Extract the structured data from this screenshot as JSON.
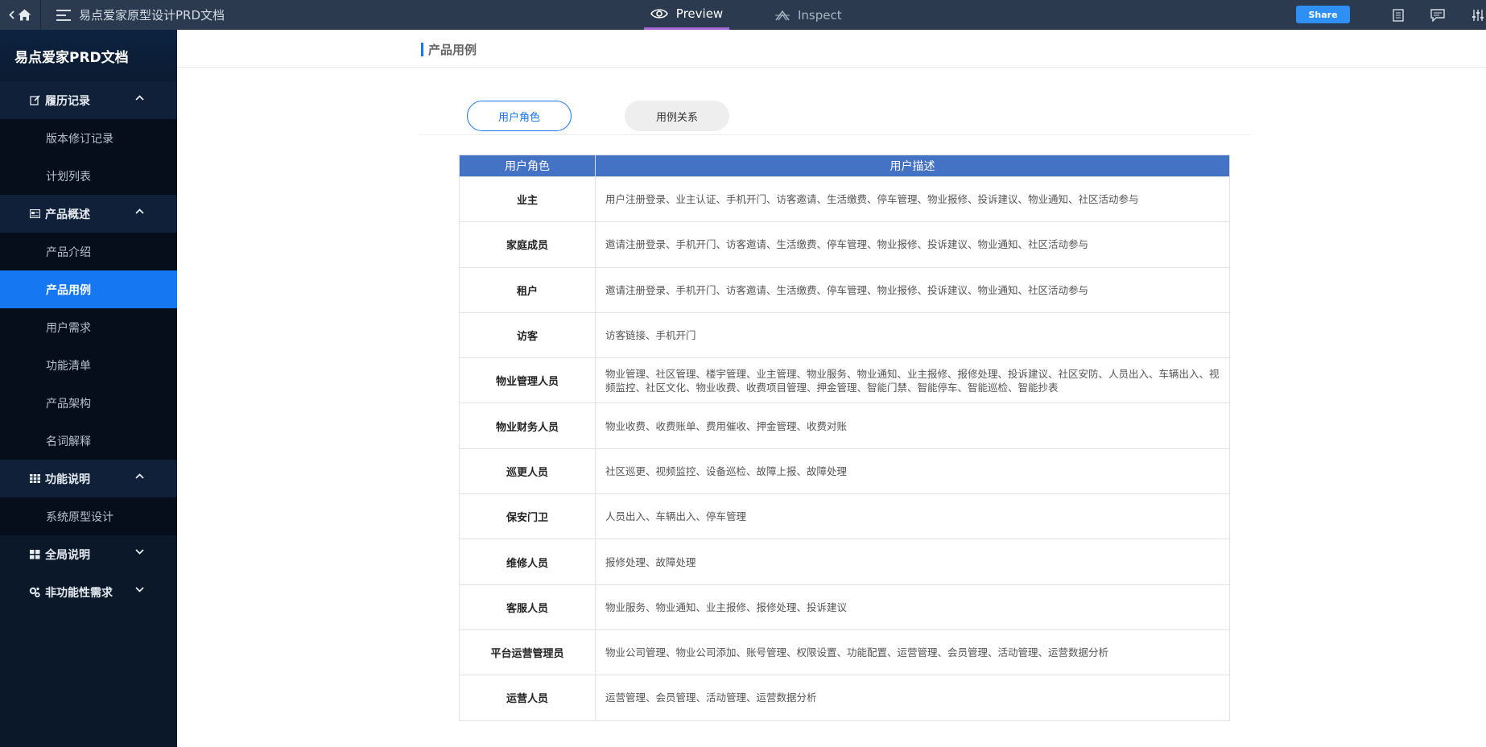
{
  "topbar": {
    "doc_title": "易点爱家原型设计PRD文档",
    "tabs": {
      "preview": "Preview",
      "inspect": "Inspect"
    },
    "share_label": "Share"
  },
  "sidebar": {
    "header": "易点爱家PRD文档",
    "groups": [
      {
        "label": "履历记录",
        "icon": "edit-icon",
        "expanded": true,
        "items": [
          "版本修订记录",
          "计划列表"
        ]
      },
      {
        "label": "产品概述",
        "icon": "document-icon",
        "expanded": true,
        "items": [
          "产品介绍",
          "产品用例",
          "用户需求",
          "功能清单",
          "产品架构",
          "名词解释"
        ]
      },
      {
        "label": "功能说明",
        "icon": "grid-icon",
        "expanded": true,
        "items": [
          "系统原型设计"
        ]
      },
      {
        "label": "全局说明",
        "icon": "apps-icon",
        "expanded": false,
        "items": []
      },
      {
        "label": "非功能性需求",
        "icon": "cogs-icon",
        "expanded": false,
        "items": []
      }
    ],
    "active_item": "产品用例"
  },
  "content": {
    "section_title": "产品用例",
    "tabs": {
      "active": "用户角色",
      "other": "用例关系"
    },
    "table": {
      "headers": [
        "用户角色",
        "用户描述"
      ],
      "rows": [
        {
          "role": "业主",
          "desc": "用户注册登录、业主认证、手机开门、访客邀请、生活缴费、停车管理、物业报修、投诉建议、物业通知、社区活动参与"
        },
        {
          "role": "家庭成员",
          "desc": "邀请注册登录、手机开门、访客邀请、生活缴费、停车管理、物业报修、投诉建议、物业通知、社区活动参与"
        },
        {
          "role": "租户",
          "desc": "邀请注册登录、手机开门、访客邀请、生活缴费、停车管理、物业报修、投诉建议、物业通知、社区活动参与"
        },
        {
          "role": "访客",
          "desc": "访客链接、手机开门"
        },
        {
          "role": "物业管理人员",
          "desc": "物业管理、社区管理、楼宇管理、业主管理、物业服务、物业通知、业主报修、报修处理、投诉建议、社区安防、人员出入、车辆出入、视频监控、社区文化、物业收费、收费项目管理、押金管理、智能门禁、智能停车、智能巡检、智能抄表"
        },
        {
          "role": "物业财务人员",
          "desc": "物业收费、收费账单、费用催收、押金管理、收费对账"
        },
        {
          "role": "巡更人员",
          "desc": "社区巡更、视频监控、设备巡检、故障上报、故障处理"
        },
        {
          "role": "保安门卫",
          "desc": "人员出入、车辆出入、停车管理"
        },
        {
          "role": "维修人员",
          "desc": "报修处理、故障处理"
        },
        {
          "role": "客服人员",
          "desc": "物业服务、物业通知、业主报修、报修处理、投诉建议"
        },
        {
          "role": "平台运营管理员",
          "desc": "物业公司管理、物业公司添加、账号管理、权限设置、功能配置、运营管理、会员管理、活动管理、运营数据分析"
        },
        {
          "role": "运营人员",
          "desc": "运营管理、会员管理、活动管理、运营数据分析"
        }
      ]
    }
  }
}
